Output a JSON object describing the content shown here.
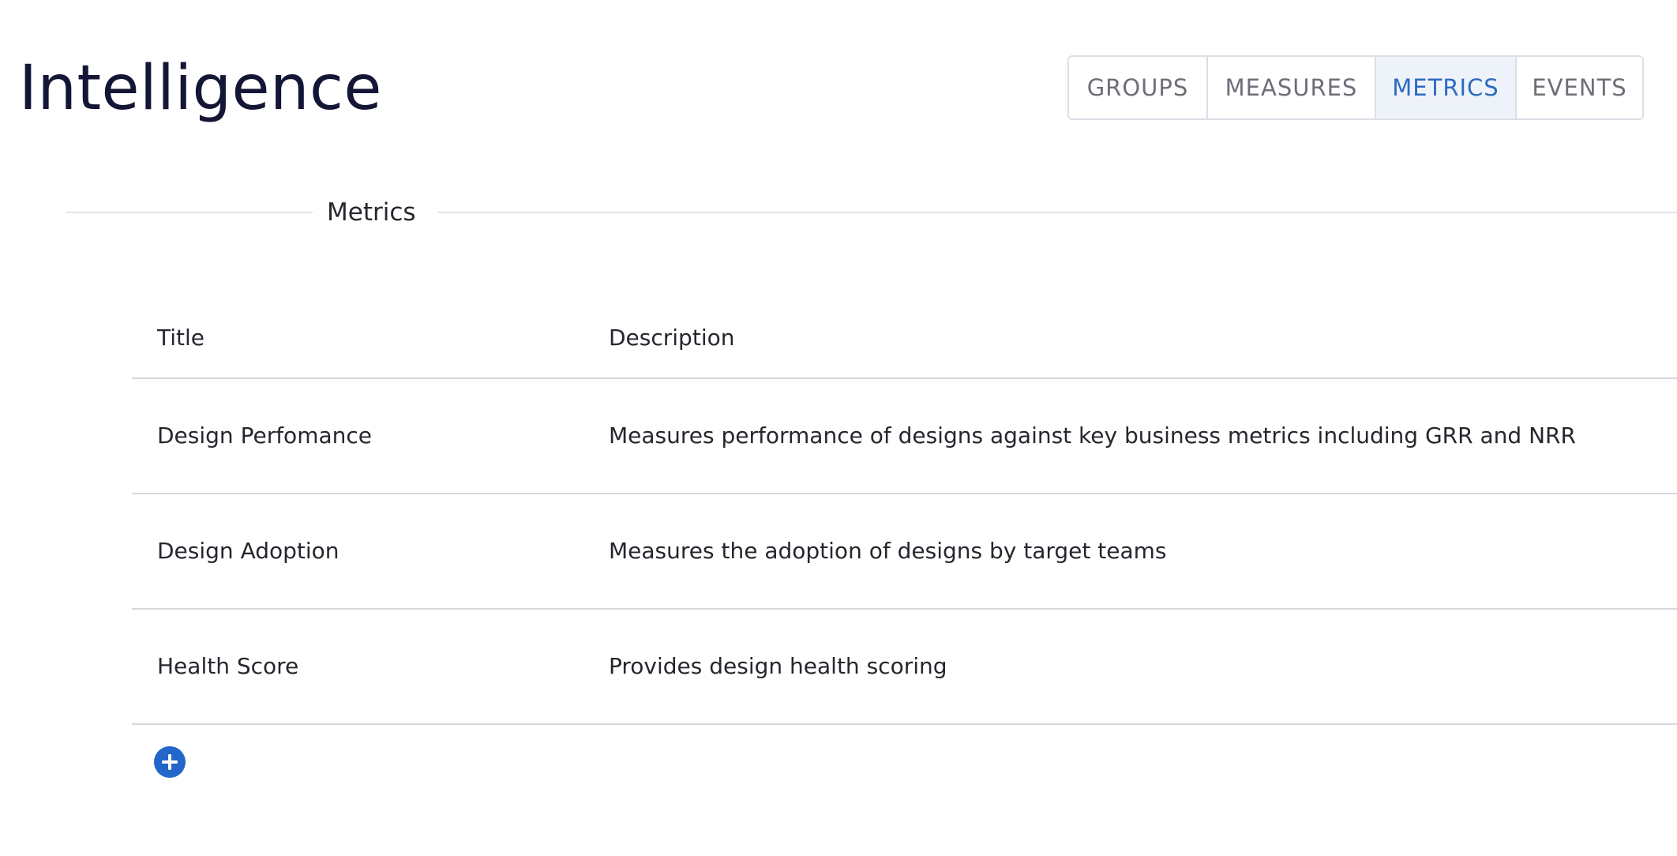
{
  "header": {
    "title": "Intelligence"
  },
  "tabs": [
    {
      "label": "GROUPS",
      "active": false
    },
    {
      "label": "MEASURES",
      "active": false
    },
    {
      "label": "METRICS",
      "active": true
    },
    {
      "label": "EVENTS",
      "active": false
    }
  ],
  "section": {
    "title": "Metrics"
  },
  "table": {
    "columns": [
      "Title",
      "Description"
    ],
    "rows": [
      {
        "title": "Design Perfomance",
        "description": "Measures performance of designs against key business metrics including GRR and NRR"
      },
      {
        "title": "Design Adoption",
        "description": "Measures the adoption of designs by target teams"
      },
      {
        "title": "Health Score",
        "description": "Provides design health scoring"
      }
    ]
  },
  "actions": {
    "add_icon": "plus-circle-icon"
  },
  "colors": {
    "accent": "#2366c9",
    "active_tab_text": "#2c6bc0",
    "active_tab_bg": "#eef3fa",
    "title_text": "#141635"
  }
}
